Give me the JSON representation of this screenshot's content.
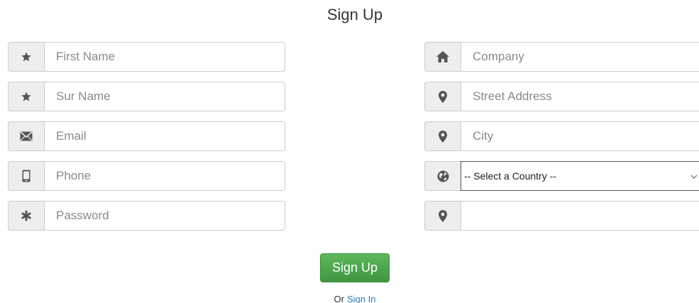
{
  "title": "Sign Up",
  "left_fields": [
    {
      "placeholder": "First Name",
      "icon": "star-icon"
    },
    {
      "placeholder": "Sur Name",
      "icon": "star-icon"
    },
    {
      "placeholder": "Email",
      "icon": "envelope-icon"
    },
    {
      "placeholder": "Phone",
      "icon": "phone-icon"
    },
    {
      "placeholder": "Password",
      "icon": "asterisk-icon"
    }
  ],
  "right_fields": [
    {
      "placeholder": "Company",
      "icon": "home-icon"
    },
    {
      "placeholder": "Street Address",
      "icon": "map-marker-icon"
    },
    {
      "placeholder": "City",
      "icon": "map-marker-icon"
    },
    {
      "select_value": "-- Select a Country --",
      "icon": "globe-icon"
    },
    {
      "placeholder": "",
      "icon": "map-marker-icon"
    }
  ],
  "submit_label": "Sign Up",
  "footer": {
    "prefix": "Or",
    "link": "Sign In"
  },
  "colors": {
    "button": "#5cb85c",
    "link": "#2a7ab8",
    "addon_bg": "#eeeeee"
  }
}
